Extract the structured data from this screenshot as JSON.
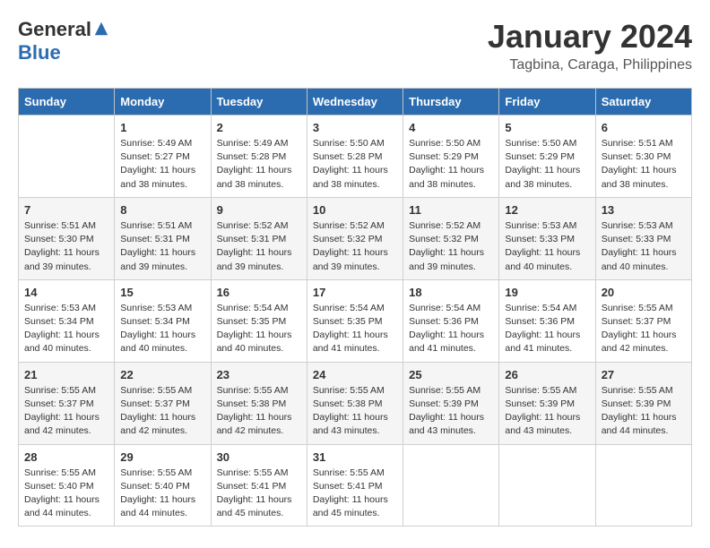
{
  "header": {
    "logo": {
      "general": "General",
      "blue": "Blue"
    },
    "title": "January 2024",
    "location": "Tagbina, Caraga, Philippines"
  },
  "weekdays": [
    "Sunday",
    "Monday",
    "Tuesday",
    "Wednesday",
    "Thursday",
    "Friday",
    "Saturday"
  ],
  "weeks": [
    [
      {
        "day": "",
        "info": ""
      },
      {
        "day": "1",
        "info": "Sunrise: 5:49 AM\nSunset: 5:27 PM\nDaylight: 11 hours and 38 minutes."
      },
      {
        "day": "2",
        "info": "Sunrise: 5:49 AM\nSunset: 5:28 PM\nDaylight: 11 hours and 38 minutes."
      },
      {
        "day": "3",
        "info": "Sunrise: 5:50 AM\nSunset: 5:28 PM\nDaylight: 11 hours and 38 minutes."
      },
      {
        "day": "4",
        "info": "Sunrise: 5:50 AM\nSunset: 5:29 PM\nDaylight: 11 hours and 38 minutes."
      },
      {
        "day": "5",
        "info": "Sunrise: 5:50 AM\nSunset: 5:29 PM\nDaylight: 11 hours and 38 minutes."
      },
      {
        "day": "6",
        "info": "Sunrise: 5:51 AM\nSunset: 5:30 PM\nDaylight: 11 hours and 38 minutes."
      }
    ],
    [
      {
        "day": "7",
        "info": "Sunrise: 5:51 AM\nSunset: 5:30 PM\nDaylight: 11 hours and 39 minutes."
      },
      {
        "day": "8",
        "info": "Sunrise: 5:51 AM\nSunset: 5:31 PM\nDaylight: 11 hours and 39 minutes."
      },
      {
        "day": "9",
        "info": "Sunrise: 5:52 AM\nSunset: 5:31 PM\nDaylight: 11 hours and 39 minutes."
      },
      {
        "day": "10",
        "info": "Sunrise: 5:52 AM\nSunset: 5:32 PM\nDaylight: 11 hours and 39 minutes."
      },
      {
        "day": "11",
        "info": "Sunrise: 5:52 AM\nSunset: 5:32 PM\nDaylight: 11 hours and 39 minutes."
      },
      {
        "day": "12",
        "info": "Sunrise: 5:53 AM\nSunset: 5:33 PM\nDaylight: 11 hours and 40 minutes."
      },
      {
        "day": "13",
        "info": "Sunrise: 5:53 AM\nSunset: 5:33 PM\nDaylight: 11 hours and 40 minutes."
      }
    ],
    [
      {
        "day": "14",
        "info": "Sunrise: 5:53 AM\nSunset: 5:34 PM\nDaylight: 11 hours and 40 minutes."
      },
      {
        "day": "15",
        "info": "Sunrise: 5:53 AM\nSunset: 5:34 PM\nDaylight: 11 hours and 40 minutes."
      },
      {
        "day": "16",
        "info": "Sunrise: 5:54 AM\nSunset: 5:35 PM\nDaylight: 11 hours and 40 minutes."
      },
      {
        "day": "17",
        "info": "Sunrise: 5:54 AM\nSunset: 5:35 PM\nDaylight: 11 hours and 41 minutes."
      },
      {
        "day": "18",
        "info": "Sunrise: 5:54 AM\nSunset: 5:36 PM\nDaylight: 11 hours and 41 minutes."
      },
      {
        "day": "19",
        "info": "Sunrise: 5:54 AM\nSunset: 5:36 PM\nDaylight: 11 hours and 41 minutes."
      },
      {
        "day": "20",
        "info": "Sunrise: 5:55 AM\nSunset: 5:37 PM\nDaylight: 11 hours and 42 minutes."
      }
    ],
    [
      {
        "day": "21",
        "info": "Sunrise: 5:55 AM\nSunset: 5:37 PM\nDaylight: 11 hours and 42 minutes."
      },
      {
        "day": "22",
        "info": "Sunrise: 5:55 AM\nSunset: 5:37 PM\nDaylight: 11 hours and 42 minutes."
      },
      {
        "day": "23",
        "info": "Sunrise: 5:55 AM\nSunset: 5:38 PM\nDaylight: 11 hours and 42 minutes."
      },
      {
        "day": "24",
        "info": "Sunrise: 5:55 AM\nSunset: 5:38 PM\nDaylight: 11 hours and 43 minutes."
      },
      {
        "day": "25",
        "info": "Sunrise: 5:55 AM\nSunset: 5:39 PM\nDaylight: 11 hours and 43 minutes."
      },
      {
        "day": "26",
        "info": "Sunrise: 5:55 AM\nSunset: 5:39 PM\nDaylight: 11 hours and 43 minutes."
      },
      {
        "day": "27",
        "info": "Sunrise: 5:55 AM\nSunset: 5:39 PM\nDaylight: 11 hours and 44 minutes."
      }
    ],
    [
      {
        "day": "28",
        "info": "Sunrise: 5:55 AM\nSunset: 5:40 PM\nDaylight: 11 hours and 44 minutes."
      },
      {
        "day": "29",
        "info": "Sunrise: 5:55 AM\nSunset: 5:40 PM\nDaylight: 11 hours and 44 minutes."
      },
      {
        "day": "30",
        "info": "Sunrise: 5:55 AM\nSunset: 5:41 PM\nDaylight: 11 hours and 45 minutes."
      },
      {
        "day": "31",
        "info": "Sunrise: 5:55 AM\nSunset: 5:41 PM\nDaylight: 11 hours and 45 minutes."
      },
      {
        "day": "",
        "info": ""
      },
      {
        "day": "",
        "info": ""
      },
      {
        "day": "",
        "info": ""
      }
    ]
  ]
}
